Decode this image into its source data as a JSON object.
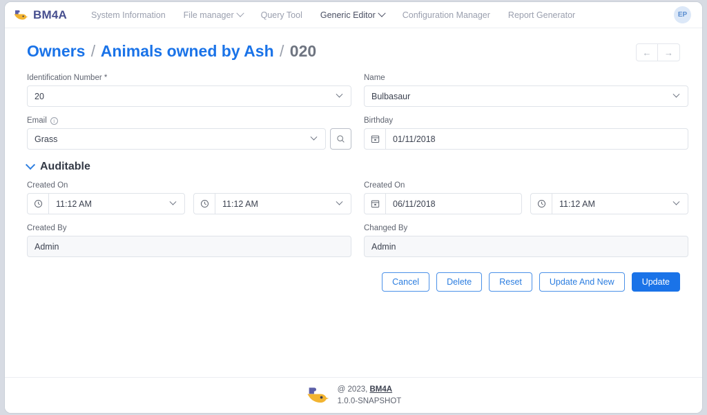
{
  "navbar": {
    "brand": "BM4A",
    "brand_icon": "bm4a-bird-logo",
    "items": [
      {
        "label": "System Information",
        "has_caret": false,
        "active": false
      },
      {
        "label": "File manager",
        "has_caret": true,
        "active": false
      },
      {
        "label": "Query Tool",
        "has_caret": false,
        "active": false
      },
      {
        "label": "Generic Editor",
        "has_caret": true,
        "active": true
      },
      {
        "label": "Configuration Manager",
        "has_caret": false,
        "active": false
      },
      {
        "label": "Report Generator",
        "has_caret": false,
        "active": false
      }
    ],
    "avatar_initials": "EP"
  },
  "title": {
    "crumb1": "Owners",
    "sep1": "/",
    "crumb2": "Animals owned by Ash",
    "sep2": "/",
    "crumb3": "020",
    "prev_icon": "arrow-left-icon",
    "next_icon": "arrow-right-icon"
  },
  "form": {
    "identification_number": {
      "label": "Identification Number *",
      "value": "20",
      "icon": "chevron-down-icon"
    },
    "name": {
      "label": "Name",
      "value": "Bulbasaur",
      "icon": "chevron-down-icon"
    },
    "email": {
      "label": "Email",
      "info_icon": "info-icon",
      "value": "Grass",
      "icon": "chevron-down-icon",
      "search_icon": "search-icon"
    },
    "birthday": {
      "label": "Birthday",
      "value": "01/11/2018",
      "icon": "calendar-icon"
    }
  },
  "auditable": {
    "section_label": "Auditable",
    "section_icon": "chevron-down-icon",
    "created_on_left_label": "Created On",
    "created_on_left_time1": "11:12 AM",
    "created_on_left_time2": "11:12 AM",
    "created_on_right_label": "Created On",
    "created_on_right_date": "06/11/2018",
    "created_on_right_time": "11:12 AM",
    "created_by_label": "Created By",
    "created_by_value": "Admin",
    "changed_by_label": "Changed By",
    "changed_by_value": "Admin",
    "clock_icon": "clock-icon",
    "calendar_icon": "calendar-icon"
  },
  "actions": {
    "cancel": "Cancel",
    "delete": "Delete",
    "reset": "Reset",
    "update_and_new": "Update And New",
    "update": "Update"
  },
  "footer": {
    "logo_icon": "bm4a-bird-logo",
    "copyright_prefix": "@ 2023, ",
    "copyright_brand": "BM4A",
    "version": "1.0.0-SNAPSHOT"
  },
  "colors": {
    "accent": "#1a73e8",
    "brand_purple": "#474f8f",
    "brand_yellow": "#f2b431",
    "muted": "#9a9fae"
  }
}
